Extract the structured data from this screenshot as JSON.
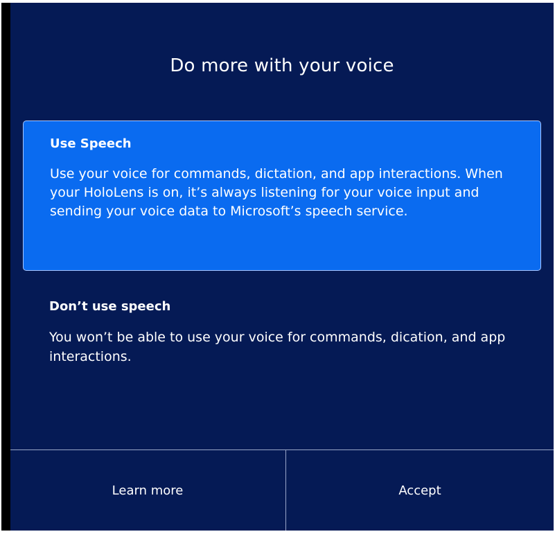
{
  "dialog": {
    "title": "Do more with your voice",
    "options": [
      {
        "title": "Use Speech",
        "description": "Use your voice for commands, dictation, and app interactions. When your HoloLens is on, it’s always listening for your voice input and sending your voice data to Microsoft’s speech service.",
        "selected": true
      },
      {
        "title": "Don’t use speech",
        "description": "You won’t be able to use your voice for commands, dication, and app interactions.",
        "selected": false
      }
    ],
    "buttons": {
      "learn_more": "Learn more",
      "accept": "Accept"
    }
  },
  "colors": {
    "background": "#051a55",
    "selected_option": "#0a6bf0",
    "text": "#ffffff"
  }
}
